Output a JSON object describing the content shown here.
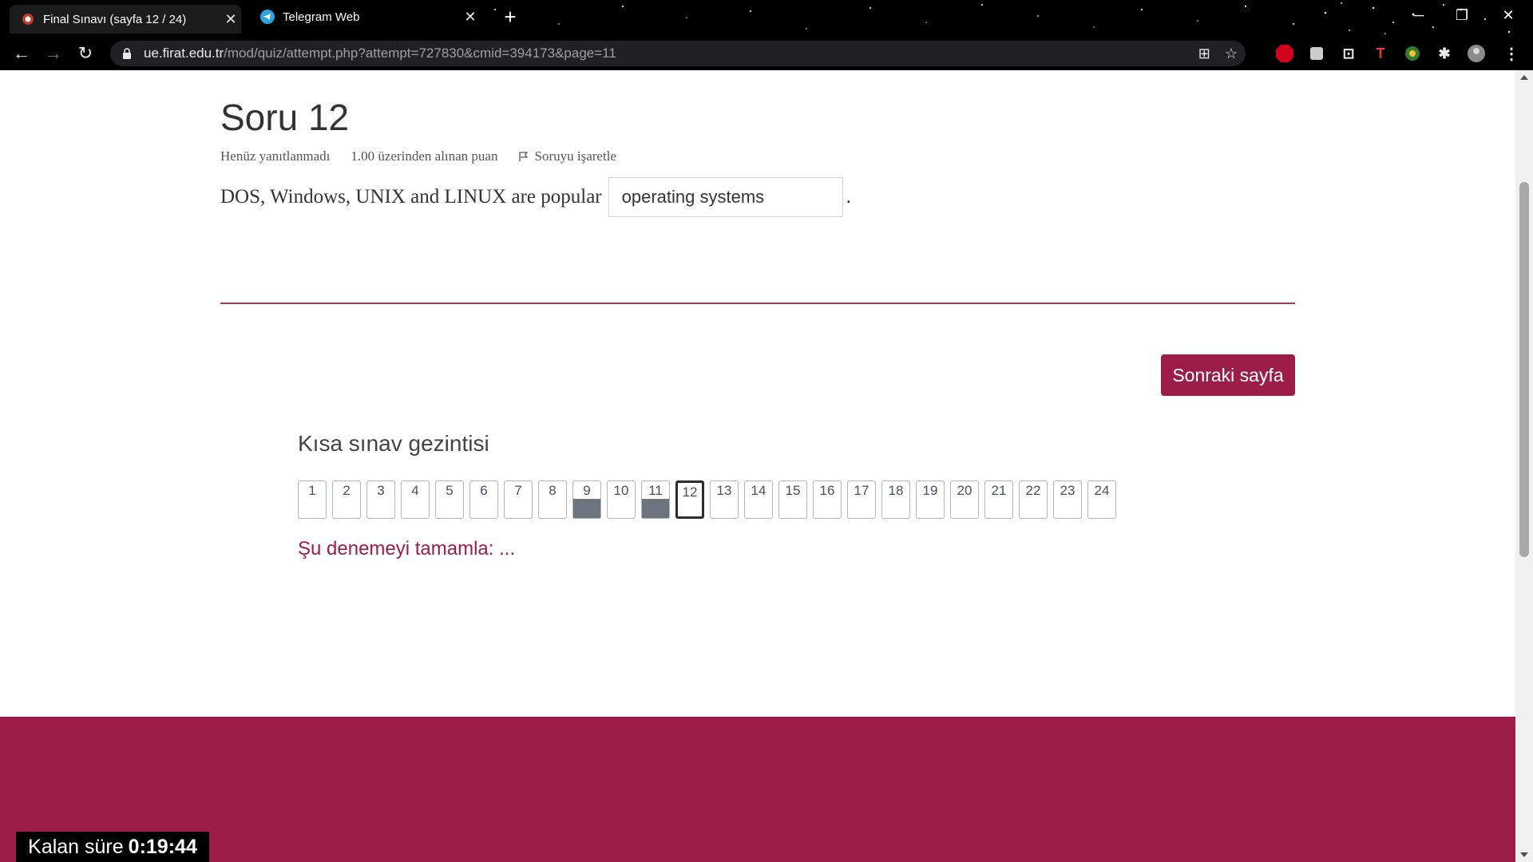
{
  "browser": {
    "tabs": [
      {
        "title": "Final Sınavı (sayfa 12 / 24)",
        "active": true
      },
      {
        "title": "Telegram Web",
        "active": false
      }
    ],
    "url_host": "ue.firat.edu.tr",
    "url_path": "/mod/quiz/attempt.php?attempt=727830&cmid=394173&page=11"
  },
  "question": {
    "title": "Soru 12",
    "status": "Henüz yanıtlanmadı",
    "grade": "1.00 üzerinden alınan puan",
    "flag_label": "Soruyu işaretle",
    "text": "DOS, Windows, UNIX and LINUX are popular",
    "answer_value": "operating systems",
    "trailing": "."
  },
  "next_button": "Sonraki sayfa",
  "quiz_nav": {
    "title": "Kısa sınav gezintisi",
    "buttons": [
      {
        "label": "1",
        "state": "empty"
      },
      {
        "label": "2",
        "state": "empty"
      },
      {
        "label": "3",
        "state": "empty"
      },
      {
        "label": "4",
        "state": "empty"
      },
      {
        "label": "5",
        "state": "empty"
      },
      {
        "label": "6",
        "state": "empty"
      },
      {
        "label": "7",
        "state": "empty"
      },
      {
        "label": "8",
        "state": "empty"
      },
      {
        "label": "9",
        "state": "answered"
      },
      {
        "label": "10",
        "state": "empty"
      },
      {
        "label": "11",
        "state": "answered"
      },
      {
        "label": "12",
        "state": "current"
      },
      {
        "label": "13",
        "state": "empty"
      },
      {
        "label": "14",
        "state": "empty"
      },
      {
        "label": "15",
        "state": "empty"
      },
      {
        "label": "16",
        "state": "empty"
      },
      {
        "label": "17",
        "state": "empty"
      },
      {
        "label": "18",
        "state": "empty"
      },
      {
        "label": "19",
        "state": "empty"
      },
      {
        "label": "20",
        "state": "empty"
      },
      {
        "label": "21",
        "state": "empty"
      },
      {
        "label": "22",
        "state": "empty"
      },
      {
        "label": "23",
        "state": "empty"
      },
      {
        "label": "24",
        "state": "empty"
      }
    ],
    "finish_link": "Şu denemeyi tamamla: ..."
  },
  "timer": {
    "label": "Kalan süre",
    "value": "0:19:44"
  },
  "colors": {
    "brand": "#9c1e48",
    "answered": "#6c757d"
  }
}
